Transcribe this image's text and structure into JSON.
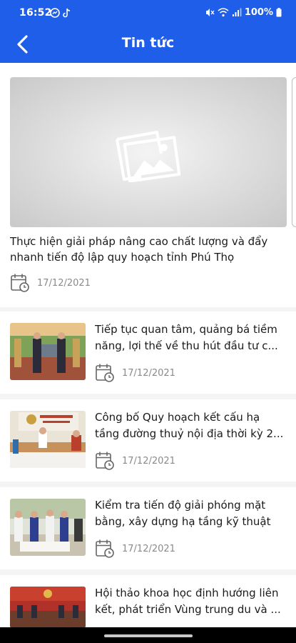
{
  "status_bar": {
    "time": "16:52",
    "left_icons": [
      "messenger-icon",
      "tiktok-icon"
    ],
    "right_icons": [
      "mute-icon",
      "wifi-icon",
      "signal-icon"
    ],
    "battery": "100%"
  },
  "app_bar": {
    "title": "Tin tức",
    "back_icon": "chevron-left-icon"
  },
  "featured": {
    "title": "Thực hiện giải pháp nâng cao chất lượng và đẩy nhanh tiến độ lập quy hoạch tỉnh Phú Thọ",
    "date": "17/12/2021",
    "image": "image-placeholder-icon"
  },
  "news": [
    {
      "title": "Tiếp tục quan tâm, quảng bá tiềm năng, lợi thế về thu hút đầu tư c...",
      "date": "17/12/2021"
    },
    {
      "title": "Công bố Quy hoạch kết cấu hạ tầng đường thuỷ nội địa thời kỳ 2...",
      "date": "17/12/2021"
    },
    {
      "title": "Kiểm tra tiến độ giải phóng mặt bằng, xây dựng hạ tầng kỹ thuật ...",
      "date": "17/12/2021"
    },
    {
      "title": "Hội thảo khoa học định hướng liên kết, phát triển Vùng trung du và ...",
      "date": ""
    }
  ],
  "colors": {
    "primary": "#1f5ee8",
    "background": "#f4f4f4",
    "date_text": "#8a8a8a"
  }
}
